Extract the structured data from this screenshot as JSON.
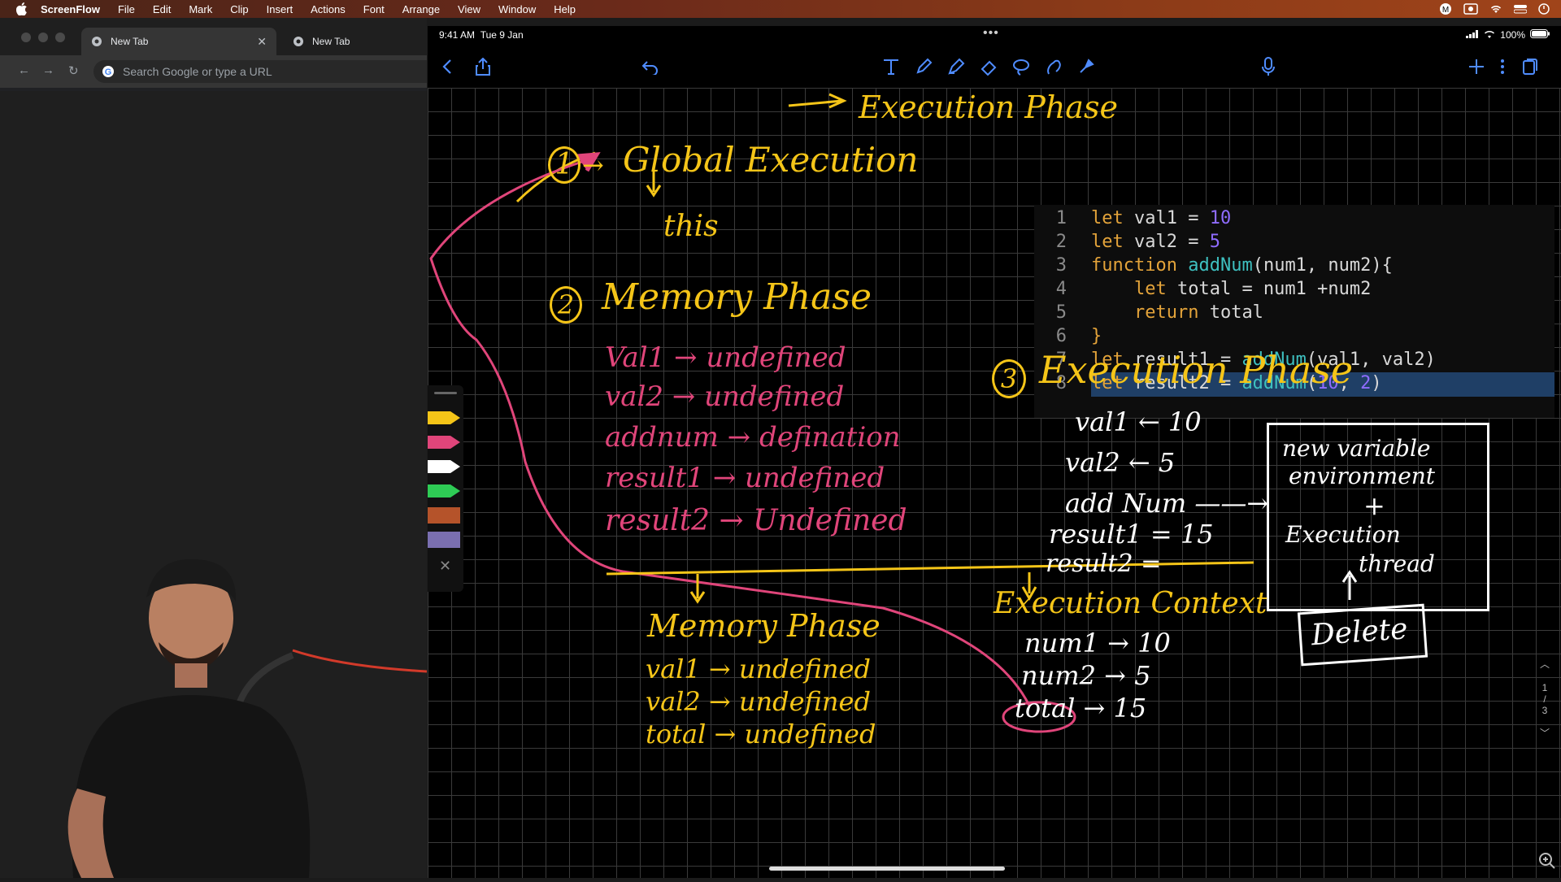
{
  "menubar": {
    "app_name": "ScreenFlow",
    "items": [
      "File",
      "Edit",
      "Mark",
      "Clip",
      "Insert",
      "Actions",
      "Font",
      "Arrange",
      "View",
      "Window",
      "Help"
    ]
  },
  "chrome": {
    "tabs": [
      {
        "title": "New Tab"
      },
      {
        "title": "New Tab"
      }
    ],
    "omnibox_placeholder": "Search Google or type a URL"
  },
  "ipad": {
    "status": {
      "time": "9:41 AM",
      "date": "Tue 9 Jan",
      "battery": "100%"
    },
    "notes": {
      "top_title": "Execution Phase",
      "step1_num": "1",
      "step1_title": "Global Execution",
      "step1_this": "this",
      "step2_num": "2",
      "step2_title": "Memory Phase",
      "memory_items": [
        "Val1 → undefined",
        "val2 → undefined",
        "addnum → defination",
        "result1 → undefined",
        "result2 → Undefined"
      ],
      "step3_num": "3",
      "step3_title": "Execution Phase",
      "exec_items": [
        "val1 ← 10",
        "val2 ← 5",
        "add Num ——→",
        "result1 = 15",
        "result2 ="
      ],
      "env_box": [
        "new variable",
        "environment",
        "+",
        "Execution",
        "thread"
      ],
      "delete_label": "Delete",
      "sub_memory_title": "Memory Phase",
      "sub_memory_items": [
        "val1 → undefined",
        "val2 → undefined",
        "total → undefined"
      ],
      "sub_exec_title": "Execution Context",
      "sub_exec_items": [
        "num1 → 10",
        "num2 → 5",
        "total → 15"
      ]
    },
    "code": [
      {
        "n": "1",
        "parts": [
          [
            "kw",
            "let "
          ],
          [
            "plain",
            "val1 = "
          ],
          [
            "num",
            "10"
          ]
        ]
      },
      {
        "n": "2",
        "parts": [
          [
            "kw",
            "let "
          ],
          [
            "plain",
            "val2 = "
          ],
          [
            "num",
            "5"
          ]
        ]
      },
      {
        "n": "3",
        "parts": [
          [
            "kw",
            "function "
          ],
          [
            "fn",
            "addNum"
          ],
          [
            "plain",
            "(num1, num2){"
          ]
        ]
      },
      {
        "n": "4",
        "parts": [
          [
            "plain",
            "    "
          ],
          [
            "kw",
            "let "
          ],
          [
            "plain",
            "total = num1 +num2"
          ]
        ]
      },
      {
        "n": "5",
        "parts": [
          [
            "plain",
            "    "
          ],
          [
            "kw",
            "return "
          ],
          [
            "plain",
            "total"
          ]
        ]
      },
      {
        "n": "6",
        "parts": [
          [
            "kw",
            "}"
          ]
        ]
      },
      {
        "n": "7",
        "parts": [
          [
            "kw",
            "let "
          ],
          [
            "plain",
            "result1 = "
          ],
          [
            "fn",
            "addNum"
          ],
          [
            "plain",
            "(val1, val2)"
          ]
        ]
      },
      {
        "n": "8",
        "parts": [
          [
            "kw",
            "let "
          ],
          [
            "plain",
            "result2 = "
          ],
          [
            "fn",
            "addNum"
          ],
          [
            "plain",
            "("
          ],
          [
            "num",
            "10"
          ],
          [
            "plain",
            ", "
          ],
          [
            "num",
            "2"
          ],
          [
            "plain",
            ")"
          ]
        ]
      }
    ],
    "page_indicator": [
      "1",
      "/",
      "3"
    ]
  }
}
